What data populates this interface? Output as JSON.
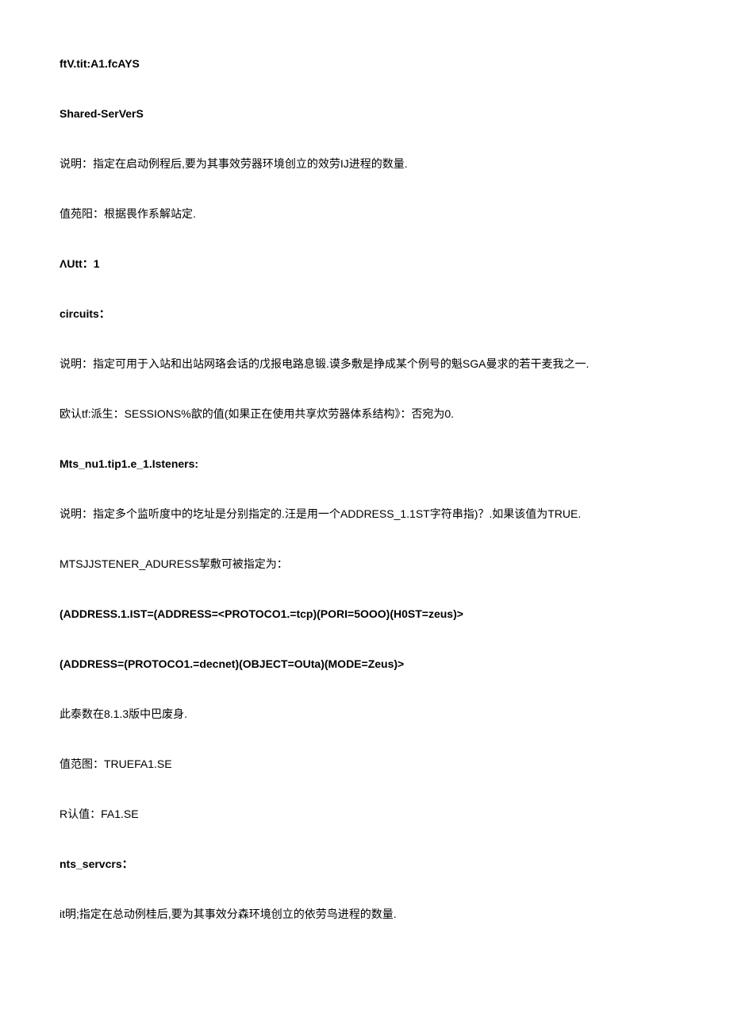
{
  "lines": [
    {
      "text": "ftV.tit:A1.fcAYS",
      "bold": true
    },
    {
      "text": "Shared-SerVerS",
      "bold": true
    },
    {
      "text": "说明：指定在启动例程后,要为其事效劳器环境创立的效劳IJ进程的数量.",
      "bold": false
    },
    {
      "text": "值苑阳：根据畏作系解站定.",
      "bold": false
    },
    {
      "text": "ΛUtt：1",
      "bold": true
    },
    {
      "text": "circuits：",
      "bold": true
    },
    {
      "text": "说明：指定可用于入站和出站网珞会话的戊报电路息锻.谟多敷是挣成某个例号的魁SGA曼求的若干麦我之一.",
      "bold": false
    },
    {
      "text": "欧认tf:派生：SESSIONS%歆的值(如果正在使用共享炊劳器体系结构》：否宛为0.",
      "bold": false
    },
    {
      "text": "Mts_nu1.tip1.e_1.Isteners:",
      "bold": true
    },
    {
      "text": "说明：指定多个监听度中的圪址是分别指定的.汪是用一个ADDRESS_1.1ST字符串指)？.如果该值为TRUE.",
      "bold": false
    },
    {
      "text": "MTSJJSTENER_ADURESS挈敷可被指定为：",
      "bold": false
    },
    {
      "text": "(ADDRESS.1.IST=(ADDRESS=<PROTOCO1.=tcp)(PORI=5OOO)(H0ST=zeus)>",
      "bold": true
    },
    {
      "text": "(ADDRESS=(PROTOCO1.=decnet)(OBJECT=OUta)(MODE=Zeus)>",
      "bold": true
    },
    {
      "text": "此泰数在8.1.3版中巴废身.",
      "bold": false
    },
    {
      "text": "值范图：TRUEFA1.SE",
      "bold": false
    },
    {
      "text": "R认值：FA1.SE",
      "bold": false
    },
    {
      "text": "nts_servcrs：",
      "bold": true
    },
    {
      "text": "it明;指定在总动例桂后,要为其事效分森环境创立的依劳鸟进程的数量.",
      "bold": false
    }
  ]
}
